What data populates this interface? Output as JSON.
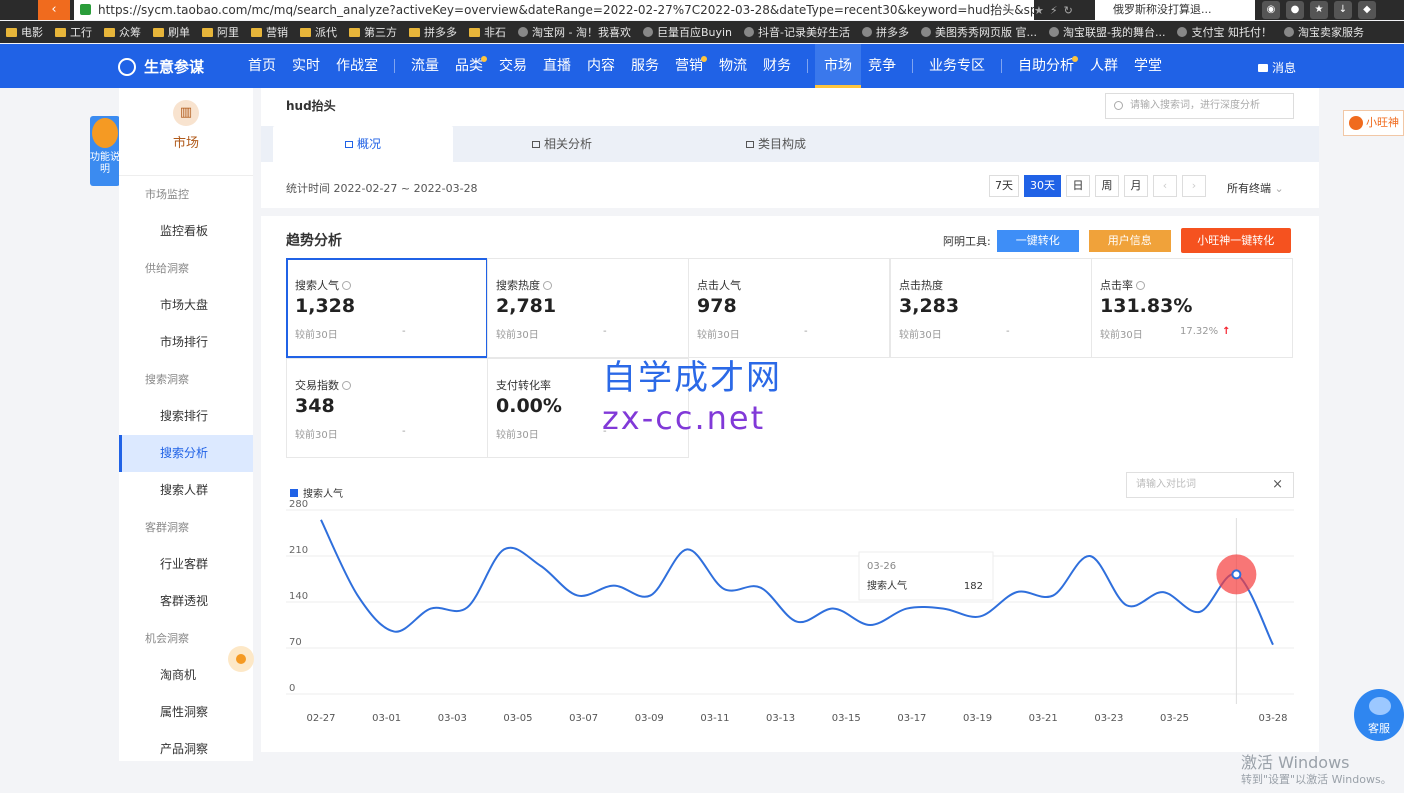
{
  "browser": {
    "url": "https://sycm.taobao.com/mc/mq/search_analyze?activeKey=overview&dateRange=2022-02-27%7C2022-03-28&dateType=recent30&keyword=hud抬头&sp...",
    "right_toolbar_text": "俄罗斯称没打算退...",
    "bookmarks": [
      "电影",
      "工行",
      "众筹",
      "刷单",
      "阿里",
      "营销",
      "派代",
      "第三方",
      "拼多多",
      "非石",
      "淘宝网 - 淘！我喜欢",
      "巨量百应Buyin",
      "抖音-记录美好生活",
      "拼多多",
      "美图秀秀网页版 官...",
      "淘宝联盟-我的舞台...",
      "支付宝 知托付！",
      "淘宝卖家服务"
    ]
  },
  "topnav": {
    "logo": "生意参谋",
    "items": [
      "首页",
      "实时",
      "作战室",
      "流量",
      "品类",
      "交易",
      "直播",
      "内容",
      "服务",
      "营销",
      "物流",
      "财务",
      "市场",
      "竞争",
      "业务专区",
      "自助分析",
      "人群",
      "学堂"
    ],
    "message": "消息"
  },
  "side_help": "功能说明",
  "sidebar": {
    "title": "市场",
    "groups": [
      {
        "label": "市场监控",
        "items": [
          "监控看板"
        ]
      },
      {
        "label": "供给洞察",
        "items": [
          "市场大盘",
          "市场排行"
        ]
      },
      {
        "label": "搜索洞察",
        "items": [
          "搜索排行",
          "搜索分析",
          "搜索人群"
        ]
      },
      {
        "label": "客群洞察",
        "items": [
          "行业客群",
          "客群透视"
        ]
      },
      {
        "label": "机会洞察",
        "items": [
          "淘商机",
          "属性洞察",
          "产品洞察"
        ]
      }
    ]
  },
  "header": {
    "keyword": "hud抬头",
    "search_placeholder": "请输入搜索词，进行深度分析",
    "tabs": [
      "概况",
      "相关分析",
      "类目构成"
    ],
    "stat_time": "统计时间 2022-02-27 ~ 2022-03-28",
    "date_buttons": [
      "7天",
      "30天",
      "日",
      "周",
      "月",
      "‹",
      "›"
    ],
    "device": "所有终端"
  },
  "trend": {
    "title": "趋势分析",
    "tools_label": "阿明工具:",
    "btn_convert": "一键转化",
    "btn_user": "用户信息",
    "btn_xiaowang": "小旺神一键转化",
    "metrics": [
      {
        "label": "搜索人气",
        "value": "1,328",
        "cmp": "较前30日",
        "change": "-"
      },
      {
        "label": "搜索热度",
        "value": "2,781",
        "cmp": "较前30日",
        "change": "-"
      },
      {
        "label": "点击人气",
        "value": "978",
        "cmp": "较前30日",
        "change": "-"
      },
      {
        "label": "点击热度",
        "value": "3,283",
        "cmp": "较前30日",
        "change": "-"
      },
      {
        "label": "点击率",
        "value": "131.83%",
        "cmp": "较前30日",
        "change": "17.32%"
      },
      {
        "label": "交易指数",
        "value": "348",
        "cmp": "较前30日",
        "change": "-"
      },
      {
        "label": "支付转化率",
        "value": "0.00%",
        "cmp": "较前30日",
        "change": "-"
      }
    ],
    "compare_placeholder": "请输入对比词",
    "compare_close": "×",
    "tooltip": {
      "date": "03-26",
      "label": "搜索人气",
      "value": "182"
    }
  },
  "chart_data": {
    "type": "line",
    "series": [
      {
        "name": "搜索人气",
        "color": "#2f6fdc",
        "values": [
          265,
          150,
          95,
          130,
          132,
          220,
          195,
          150,
          165,
          150,
          220,
          160,
          162,
          110,
          130,
          105,
          130,
          130,
          118,
          155,
          150,
          210,
          135,
          155,
          125,
          182,
          75
        ]
      }
    ],
    "x": [
      "02-27",
      "03-01",
      "03-03",
      "03-05",
      "03-07",
      "03-09",
      "03-11",
      "03-13",
      "03-15",
      "03-17",
      "03-19",
      "03-21",
      "03-23",
      "03-25",
      "03-28"
    ],
    "yticks": [
      0,
      70,
      140,
      210,
      280
    ],
    "ylim": [
      0,
      280
    ]
  },
  "watermark": {
    "line1": "自学成才网",
    "line2": "zx-cc.net"
  },
  "floating": {
    "xiaowang": "小旺神",
    "kefu": "客服"
  },
  "windows": {
    "line1": "激活 Windows",
    "line2": "转到\"设置\"以激活 Windows。"
  }
}
